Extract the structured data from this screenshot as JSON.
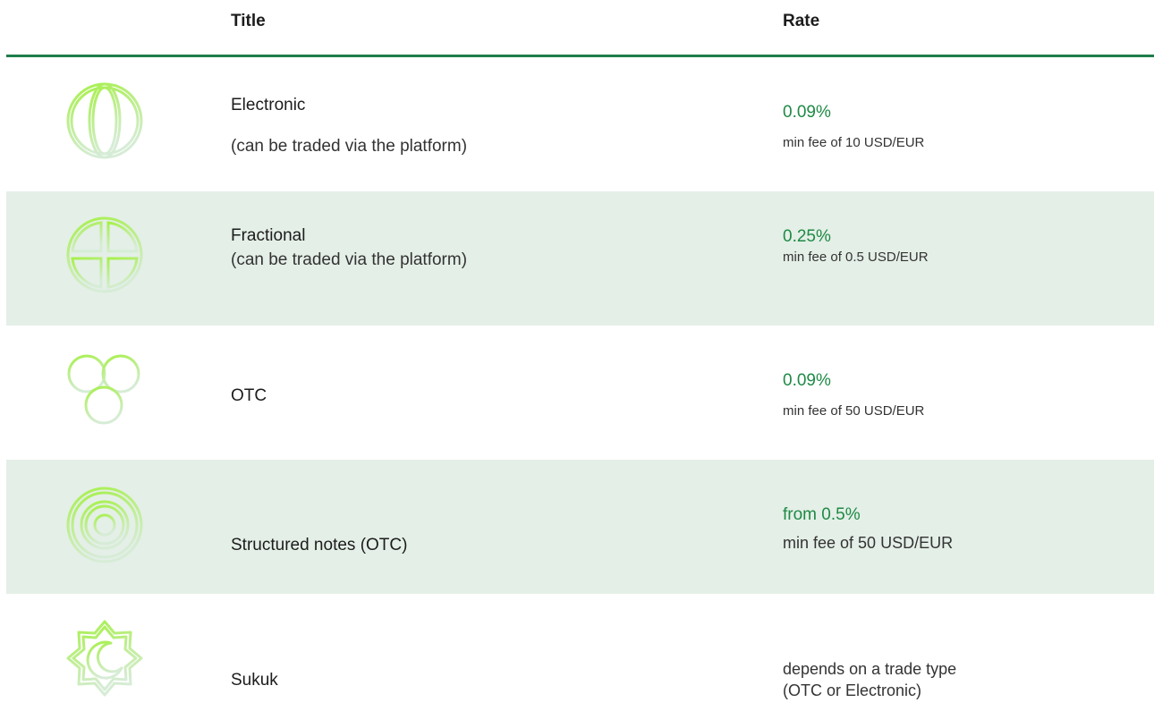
{
  "header": {
    "title_label": "Title",
    "rate_label": "Rate"
  },
  "colors": {
    "accent_line": "#1e7d4a",
    "rate_green": "#1e8a45",
    "row_shade": "#e4efe7",
    "icon_gradient_start": "#a6f04a",
    "icon_gradient_end": "#d6ecd6"
  },
  "rows": [
    {
      "icon": "globe-icon",
      "title": "Electronic",
      "subtitle": "(can be traded via the platform)",
      "rate": "0.09%",
      "note": "min fee of 10 USD/EUR"
    },
    {
      "icon": "fraction-circle-icon",
      "title": "Fractional",
      "subtitle": "(can be traded via the platform)",
      "rate": "0.25%",
      "note": "min fee of 0.5 USD/EUR"
    },
    {
      "icon": "three-circles-icon",
      "title": "OTC",
      "rate": "0.09%",
      "note": "min fee of 50 USD/EUR"
    },
    {
      "icon": "target-icon",
      "title": "Structured notes (OTC)",
      "rate": "from 0.5%",
      "note": "min fee of 50 USD/EUR"
    },
    {
      "icon": "crescent-star-icon",
      "title": "Sukuk",
      "note_line1": "depends on a trade type",
      "note_line2": "(OTC or Electronic)"
    }
  ]
}
